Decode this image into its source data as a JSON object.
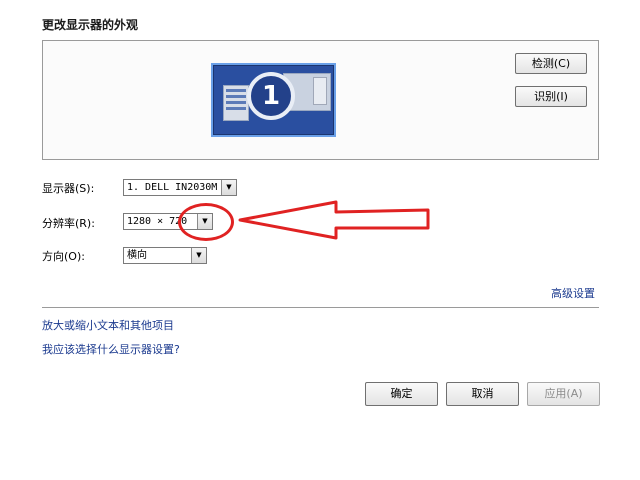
{
  "title": "更改显示器的外观",
  "preview": {
    "monitor_number": "1",
    "detect_label": "检测(C)",
    "identify_label": "识别(I)"
  },
  "fields": {
    "display_label": "显示器(S):",
    "display_value": "1. DELL IN2030M",
    "resolution_label": "分辨率(R):",
    "resolution_value": "1280 × 720",
    "orientation_label": "方向(O):",
    "orientation_value": "横向"
  },
  "links": {
    "advanced": "高级设置",
    "text_size": "放大或缩小文本和其他项目",
    "which_settings": "我应该选择什么显示器设置?"
  },
  "buttons": {
    "ok": "确定",
    "cancel": "取消",
    "apply": "应用(A)"
  },
  "annotation": {
    "circle_color": "#e02222",
    "arrow_color": "#e02222"
  }
}
